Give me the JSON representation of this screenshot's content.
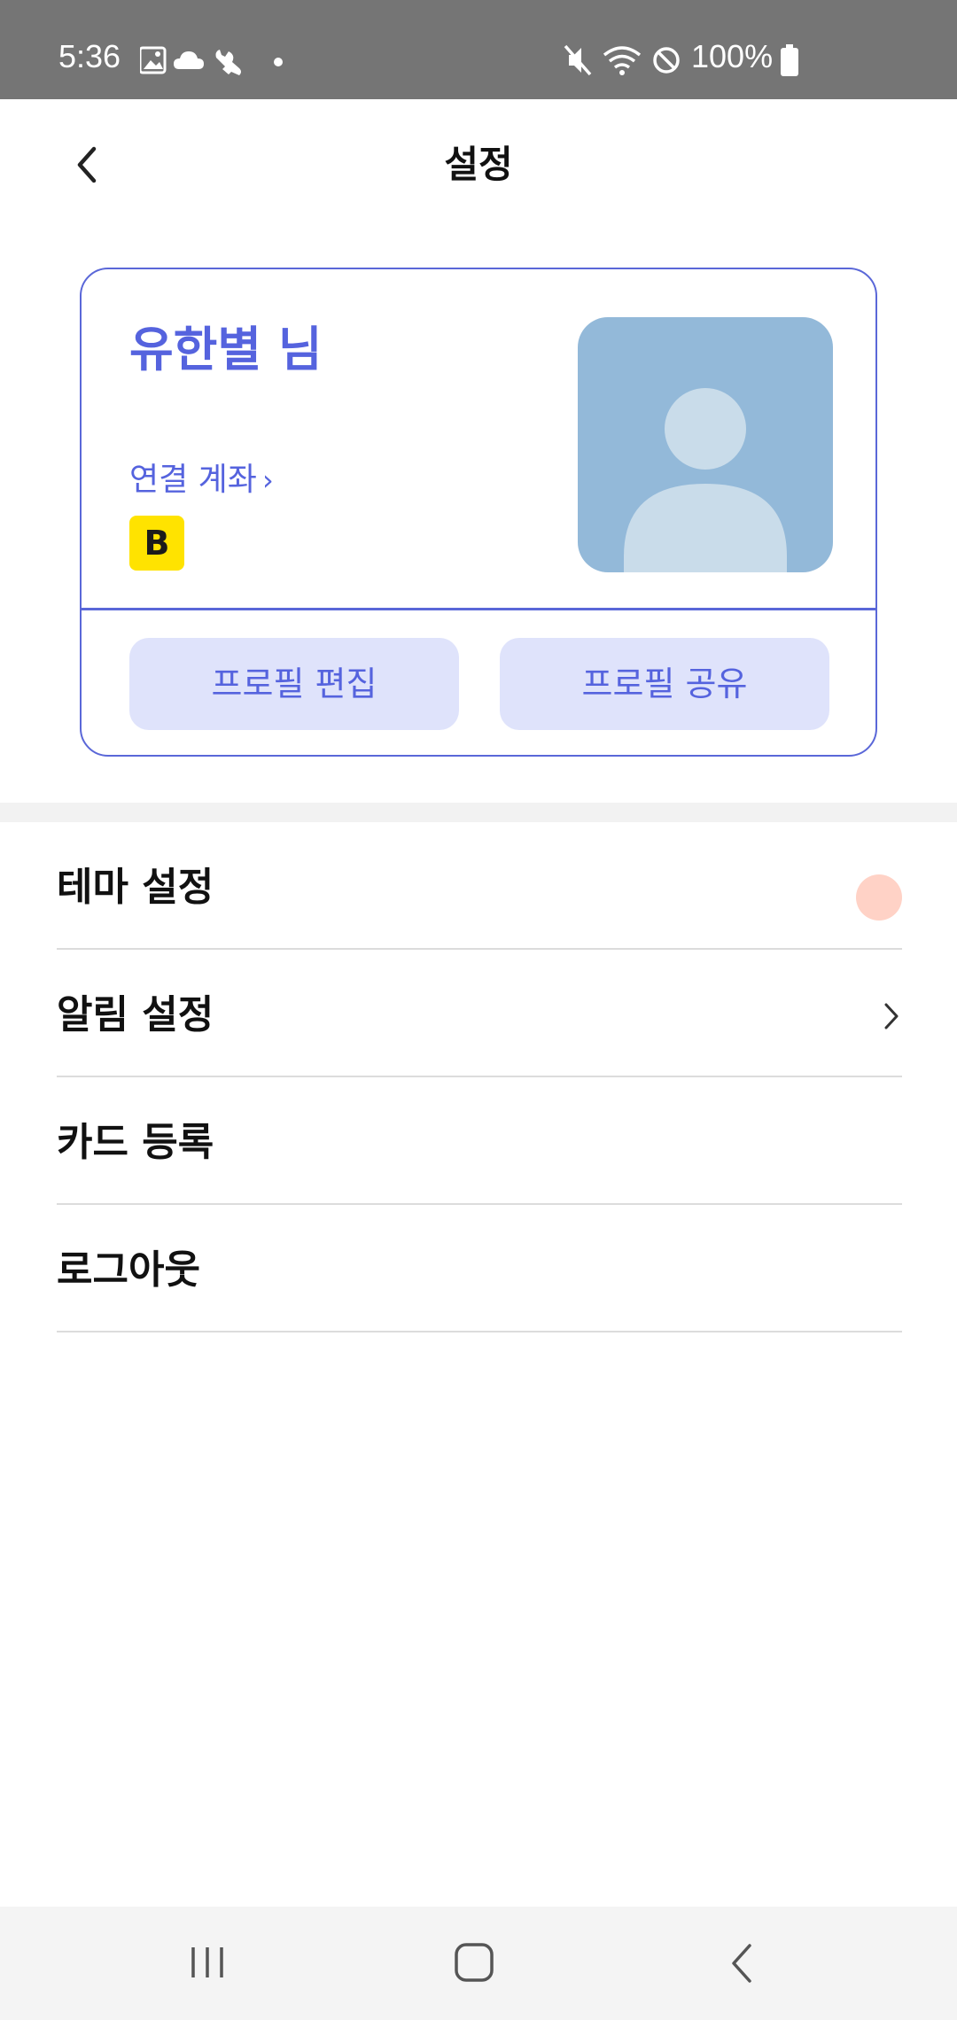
{
  "status_bar": {
    "time": "5:36",
    "battery_text": "100%",
    "left_icons": [
      "image-icon",
      "cloud-icon",
      "wrench-icon",
      "dot-icon"
    ],
    "right_icons": [
      "mute-icon",
      "wifi-icon",
      "block-icon",
      "battery-icon"
    ]
  },
  "header": {
    "title": "설정"
  },
  "profile": {
    "name": "유한별 님",
    "linked_account_label": "연결 계좌",
    "linked_account_chevron": "›",
    "bank_badge_text": "B",
    "edit_button": "프로필 편집",
    "share_button": "프로필 공유"
  },
  "menu": {
    "items": [
      {
        "label": "테마 설정"
      },
      {
        "label": "알림 설정"
      },
      {
        "label": "카드 등록"
      },
      {
        "label": "로그아웃"
      }
    ]
  },
  "colors": {
    "accent": "#5563de",
    "button_bg": "#dfe3fb",
    "avatar_bg": "#93b9d9",
    "avatar_figure": "#c9dcea",
    "theme_dot": "#ffd2c6",
    "bank_badge": "#ffe300",
    "status_bar": "#757575"
  }
}
